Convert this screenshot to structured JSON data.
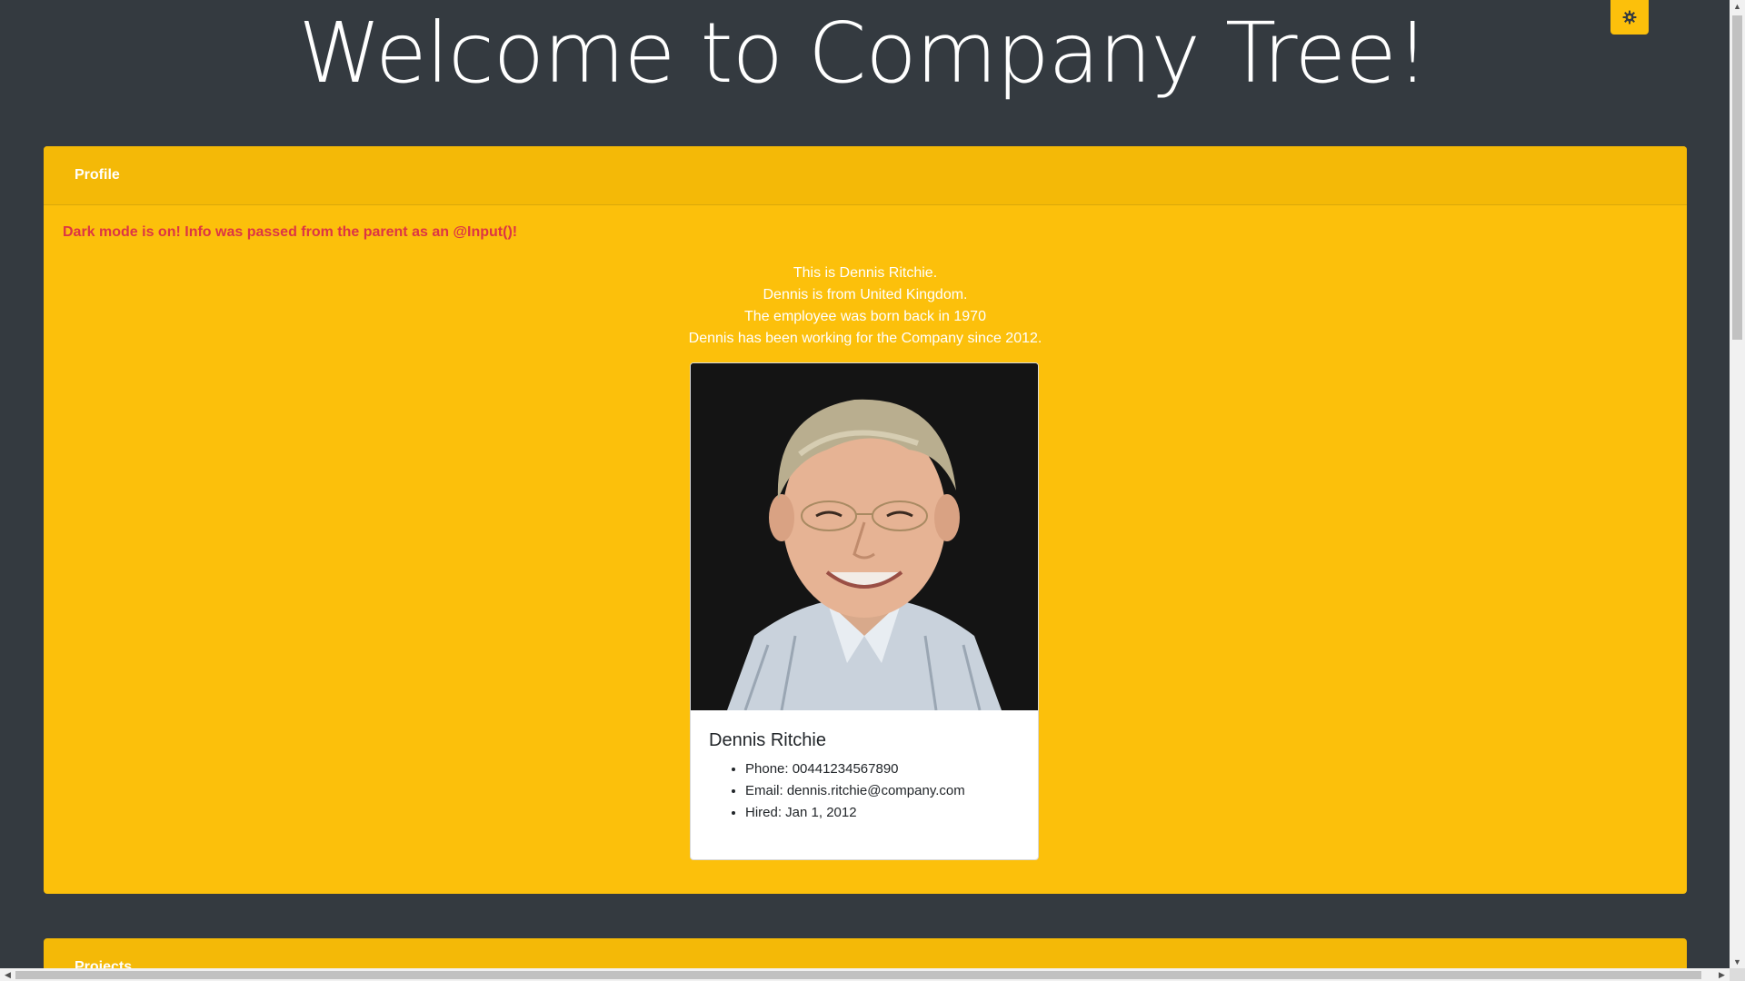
{
  "header": {
    "title": "Welcome to Company Tree!",
    "theme_toggle_icon": "gear-icon"
  },
  "profile_card": {
    "header_label": "Profile",
    "dark_mode_note": "Dark mode is on! Info was passed from the parent as an @Input()!",
    "intro_lines": [
      "This is Dennis Ritchie.",
      "Dennis is from United Kingdom.",
      "The employee was born back in 1970",
      "Dennis has been working for the Company since 2012."
    ],
    "employee": {
      "name": "Dennis Ritchie",
      "details": [
        "Phone: 00441234567890",
        "Email: dennis.ritchie@company.com",
        "Hired: Jan 1, 2012"
      ]
    }
  },
  "second_card": {
    "header_label": "Projects"
  },
  "colors": {
    "page_background": "#343a40",
    "accent": "#fcc00b",
    "alert_text": "#dc3545"
  }
}
